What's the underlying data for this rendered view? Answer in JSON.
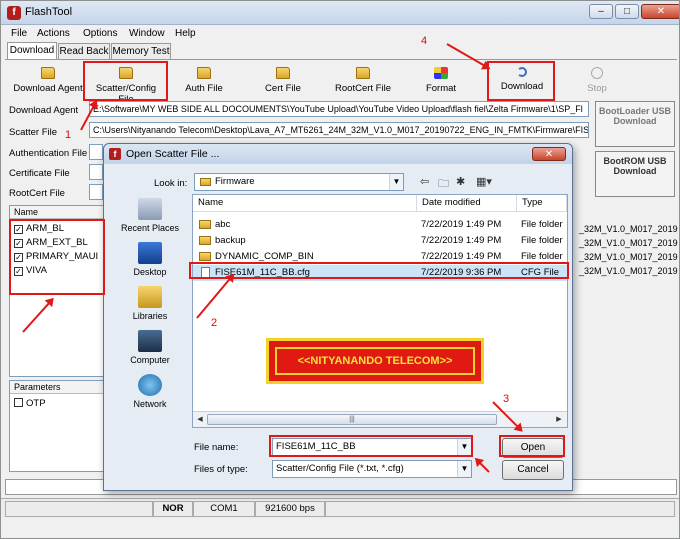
{
  "window": {
    "title": "FlashTool",
    "controls": [
      "–",
      "□",
      "✕"
    ]
  },
  "menu": [
    "File",
    "Actions",
    "Options",
    "Window",
    "Help"
  ],
  "tabs": [
    "Download",
    "Read Back",
    "Memory Test"
  ],
  "toolbar": {
    "download_agent": "Download Agent",
    "scatter_config": "Scatter/Config File",
    "auth_file": "Auth File",
    "cert_file": "Cert File",
    "rootcert_file": "RootCert File",
    "format": "Format",
    "download": "Download",
    "stop": "Stop"
  },
  "fields": {
    "download_agent_label": "Download Agent",
    "download_agent_value": "E:\\Software\\MY WEB SIDE ALL DOCOUMENTS\\YouTube Upload\\YouTube Video Upload\\flash fiel\\Zelta Firmware\\1\\SP_Fl",
    "scatter_label": "Scatter File",
    "scatter_value": "C:\\Users\\Nityanando Telecom\\Desktop\\Lava_A7_MT6261_24M_32M_V1.0_M017_20190722_ENG_IN_FMTK\\Firmware\\FIS",
    "auth_label": "Authentication File",
    "cert_label": "Certificate File",
    "rootcert_label": "RootCert File"
  },
  "side_buttons": {
    "bootloader": "BootLoader USB Download",
    "bootrom": "BootROM USB Download"
  },
  "list": {
    "header": "Name",
    "items": [
      "ARM_BL",
      "ARM_EXT_BL",
      "PRIMARY_MAUI",
      "VIVA"
    ]
  },
  "background_paths": [
    "_32M_V1.0_M017_2019",
    "_32M_V1.0_M017_2019",
    "_32M_V1.0_M017_2019",
    "_32M_V1.0_M017_2019"
  ],
  "params": {
    "header": "Parameters",
    "otp": "OTP"
  },
  "status": {
    "nor": "NOR",
    "com": "COM1",
    "baud": "921600 bps"
  },
  "dialog": {
    "title": "Open Scatter File ...",
    "look_in_label": "Look in:",
    "look_in_value": "Firmware",
    "places": [
      "Recent Places",
      "Desktop",
      "Libraries",
      "Computer",
      "Network"
    ],
    "columns": {
      "name": "Name",
      "date": "Date modified",
      "type": "Type"
    },
    "files": [
      {
        "name": "abc",
        "date": "7/22/2019 1:49 PM",
        "type": "File folder",
        "kind": "folder"
      },
      {
        "name": "backup",
        "date": "7/22/2019 1:49 PM",
        "type": "File folder",
        "kind": "folder"
      },
      {
        "name": "DYNAMIC_COMP_BIN",
        "date": "7/22/2019 1:49 PM",
        "type": "File folder",
        "kind": "folder"
      },
      {
        "name": "FISE61M_11C_BB.cfg",
        "date": "7/22/2019 9:36 PM",
        "type": "CFG File",
        "kind": "file"
      }
    ],
    "file_name_label": "File name:",
    "file_name_value": "FISE61M_11C_BB",
    "file_type_label": "Files of type:",
    "file_type_value": "Scatter/Config File (*.txt, *.cfg)",
    "open_button": "Open",
    "cancel_button": "Cancel"
  },
  "annotations": {
    "step1": "1",
    "step2": "2",
    "step3": "3",
    "step4": "4",
    "banner": "<<NITYANANDO TELECOM>>"
  },
  "colors": {
    "annotation_red": "#e01818",
    "banner_yellow": "#f2d327",
    "selection_blue": "#cce4f7"
  }
}
